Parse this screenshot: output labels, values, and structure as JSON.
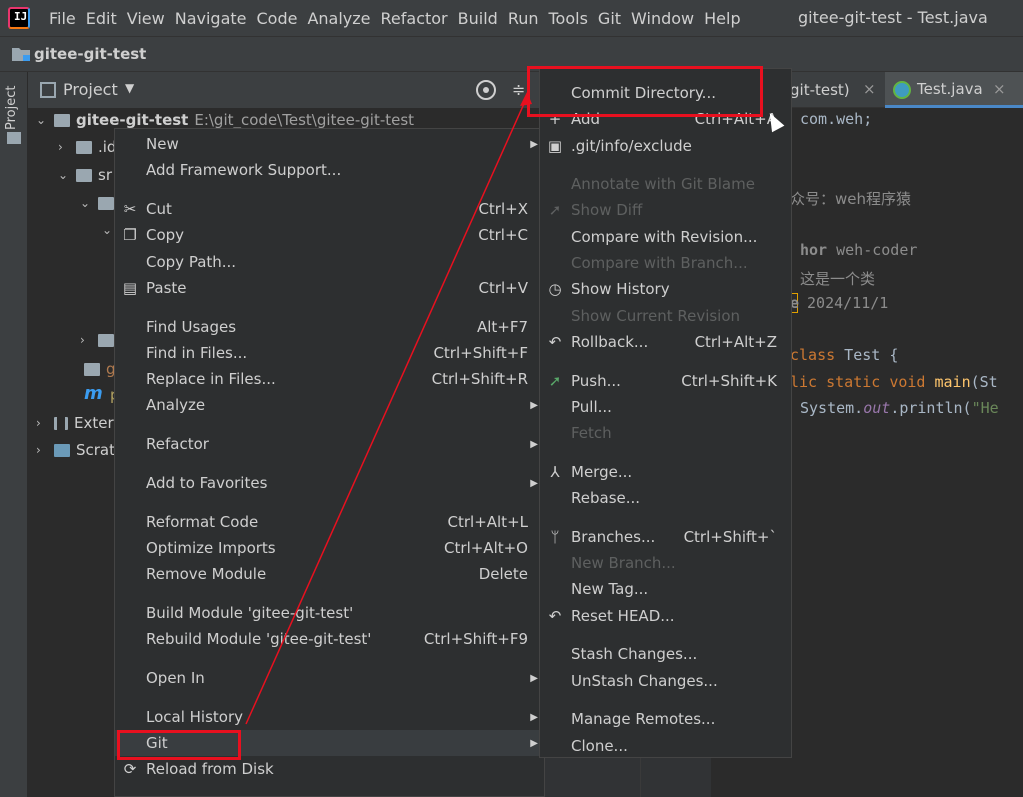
{
  "menubar": {
    "logo_text": "IJ",
    "items": [
      "File",
      "Edit",
      "View",
      "Navigate",
      "Code",
      "Analyze",
      "Refactor",
      "Build",
      "Run",
      "Tools",
      "Git",
      "Window",
      "Help"
    ],
    "window_title": "gitee-git-test - Test.java"
  },
  "navbar": {
    "project_name": "gitee-git-test"
  },
  "sidebar": {
    "stripe_label": "Project"
  },
  "project_panel": {
    "title": "Project",
    "tree": [
      {
        "label": "gitee-git-test",
        "sub": "E:\\git_code\\Test\\gitee-git-test"
      },
      {
        "label": ".id"
      },
      {
        "label": "sr"
      },
      {
        "label": ""
      },
      {
        "label": ""
      },
      {
        "label": ""
      },
      {
        "label": "g"
      },
      {
        "label": "p"
      },
      {
        "label": "Exter"
      },
      {
        "label": "Scrat"
      }
    ]
  },
  "editor": {
    "tab_prev": "git-test)",
    "tab_active": "Test.java",
    "lines": {
      "pkg": "com.weh;",
      "comment": "众号：weh程序猿",
      "author_tag": "hor",
      "author": " weh-coder",
      "desc": "这是一个类",
      "date_tag": "e",
      "date": "2024/11/1",
      "class_kw": "class",
      "class_name": " Test {",
      "pub": "lic",
      "static_kw": " static void",
      "main": " main",
      "main_args": "(St",
      "sys": "System.",
      "out": "out",
      "println": ".println(",
      "str": "\"He"
    }
  },
  "context_menu": {
    "items": [
      {
        "label": "New",
        "shortcut": "",
        "submenu": true
      },
      {
        "label": "Add Framework Support...",
        "shortcut": ""
      },
      {
        "label": "Cut",
        "shortcut": "Ctrl+X"
      },
      {
        "label": "Copy",
        "shortcut": "Ctrl+C"
      },
      {
        "label": "Copy Path...",
        "shortcut": ""
      },
      {
        "label": "Paste",
        "shortcut": "Ctrl+V"
      },
      {
        "label": "Find Usages",
        "shortcut": "Alt+F7"
      },
      {
        "label": "Find in Files...",
        "shortcut": "Ctrl+Shift+F"
      },
      {
        "label": "Replace in Files...",
        "shortcut": "Ctrl+Shift+R"
      },
      {
        "label": "Analyze",
        "shortcut": "",
        "submenu": true
      },
      {
        "label": "Refactor",
        "shortcut": "",
        "submenu": true
      },
      {
        "label": "Add to Favorites",
        "shortcut": "",
        "submenu": true
      },
      {
        "label": "Reformat Code",
        "shortcut": "Ctrl+Alt+L"
      },
      {
        "label": "Optimize Imports",
        "shortcut": "Ctrl+Alt+O"
      },
      {
        "label": "Remove Module",
        "shortcut": "Delete"
      },
      {
        "label": "Build Module 'gitee-git-test'",
        "shortcut": ""
      },
      {
        "label": "Rebuild Module 'gitee-git-test'",
        "shortcut": "Ctrl+Shift+F9"
      },
      {
        "label": "Open In",
        "shortcut": "",
        "submenu": true
      },
      {
        "label": "Local History",
        "shortcut": "",
        "submenu": true
      },
      {
        "label": "Git",
        "shortcut": "",
        "submenu": true
      },
      {
        "label": "Reload from Disk",
        "shortcut": ""
      }
    ]
  },
  "git_menu": {
    "items": [
      {
        "label": "Commit Directory...",
        "shortcut": ""
      },
      {
        "label": "Add",
        "shortcut": "Ctrl+Alt+A"
      },
      {
        "label": ".git/info/exclude",
        "shortcut": ""
      },
      {
        "label": "Annotate with Git Blame",
        "shortcut": ""
      },
      {
        "label": "Show Diff",
        "shortcut": ""
      },
      {
        "label": "Compare with Revision...",
        "shortcut": ""
      },
      {
        "label": "Compare with Branch...",
        "shortcut": ""
      },
      {
        "label": "Show History",
        "shortcut": ""
      },
      {
        "label": "Show Current Revision",
        "shortcut": ""
      },
      {
        "label": "Rollback...",
        "shortcut": "Ctrl+Alt+Z"
      },
      {
        "label": "Push...",
        "shortcut": "Ctrl+Shift+K"
      },
      {
        "label": "Pull...",
        "shortcut": ""
      },
      {
        "label": "Fetch",
        "shortcut": ""
      },
      {
        "label": "Merge...",
        "shortcut": ""
      },
      {
        "label": "Rebase...",
        "shortcut": ""
      },
      {
        "label": "Branches...",
        "shortcut": "Ctrl+Shift+`"
      },
      {
        "label": "New Branch...",
        "shortcut": ""
      },
      {
        "label": "New Tag...",
        "shortcut": ""
      },
      {
        "label": "Reset HEAD...",
        "shortcut": ""
      },
      {
        "label": "Stash Changes...",
        "shortcut": ""
      },
      {
        "label": "UnStash Changes...",
        "shortcut": ""
      },
      {
        "label": "Manage Remotes...",
        "shortcut": ""
      },
      {
        "label": "Clone...",
        "shortcut": ""
      }
    ]
  },
  "colors": {
    "annotation_red": "#e8101f",
    "accent_blue": "#4a88c7",
    "push_green": "#59a869"
  }
}
